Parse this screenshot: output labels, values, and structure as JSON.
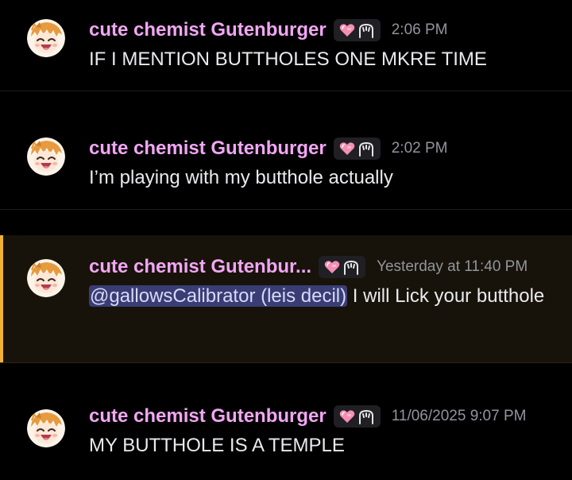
{
  "colors": {
    "background": "#000000",
    "username": "#f1a6f3",
    "message_text": "#e9eaee",
    "timestamp": "#93949c",
    "mention_bg": "#3a3d74",
    "highlight_bg": "#17130a",
    "highlight_bar": "#f0b232",
    "badge_bg": "#1f1f24"
  },
  "messages": [
    {
      "author": "cute chemist Gutenburger",
      "badge_icons": [
        "heart-icon",
        "paw-icon"
      ],
      "timestamp": "2:06 PM",
      "text": "IF I MENTION BUTTHOLES ONE MKRE TIME"
    },
    {
      "author": "cute chemist Gutenburger",
      "badge_icons": [
        "heart-icon",
        "paw-icon"
      ],
      "timestamp": "2:02 PM",
      "text": "I’m playing with my butthole actually"
    },
    {
      "author": "cute chemist Gutenbur...",
      "badge_icons": [
        "heart-icon",
        "paw-icon"
      ],
      "timestamp": "Yesterday at 11:40 PM",
      "highlighted": true,
      "mention": "@gallowsCalibrator (leis decil)",
      "text": " I will Lick your butthole"
    },
    {
      "author": "cute chemist Gutenburger",
      "badge_icons": [
        "heart-icon",
        "paw-icon"
      ],
      "timestamp": "11/06/2025 9:07 PM",
      "text": "MY BUTTHOLE IS A TEMPLE"
    }
  ]
}
